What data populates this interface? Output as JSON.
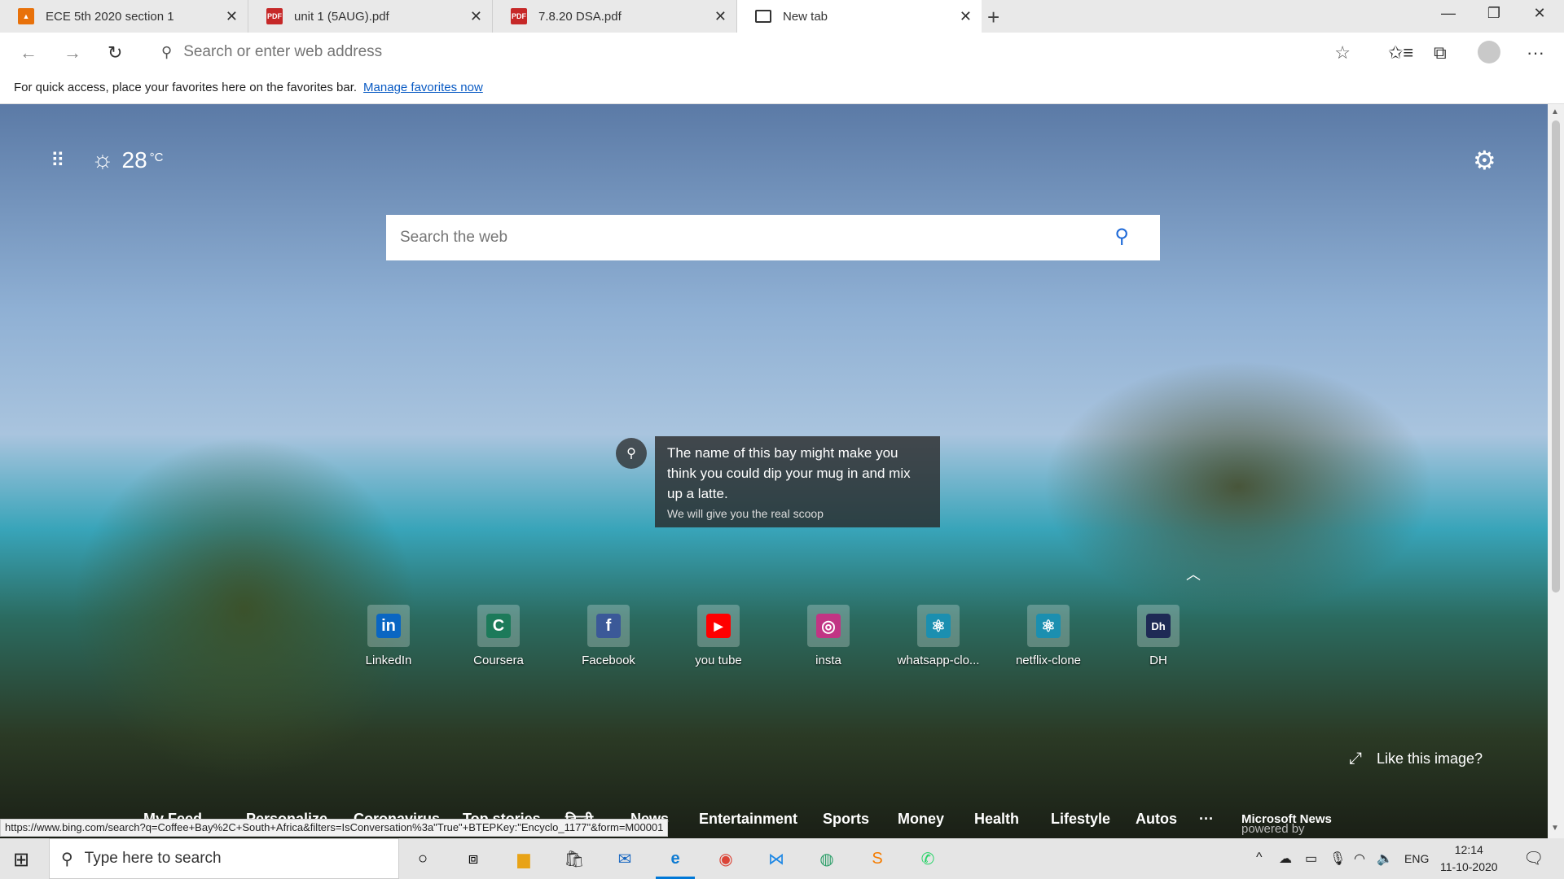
{
  "tabs": [
    {
      "title": "ECE 5th 2020 section 1",
      "icon": "classroom-icon",
      "color": "#e8710a"
    },
    {
      "title": "unit 1 (5AUG).pdf",
      "icon": "pdf-icon",
      "color": "#c62828"
    },
    {
      "title": "7.8.20 DSA.pdf",
      "icon": "pdf-icon",
      "color": "#c62828"
    },
    {
      "title": "New tab",
      "icon": "newtab-icon",
      "color": "#333333"
    }
  ],
  "address_bar": {
    "placeholder": "Search or enter web address"
  },
  "favorites_bar": {
    "message": "For quick access, place your favorites here on the favorites bar.",
    "link": "Manage favorites now"
  },
  "weather": {
    "temp": "28",
    "unit": "°C"
  },
  "web_search": {
    "placeholder": "Search the web"
  },
  "image_fact": {
    "headline": "The name of this bay might make you think you could dip your mug in and mix up a latte.",
    "subtext": "We will give you the real scoop"
  },
  "quick_links": [
    {
      "label": "LinkedIn",
      "glyph": "in",
      "color": "#0a66c2"
    },
    {
      "label": "Coursera",
      "glyph": "C",
      "color": "#1c7a5a"
    },
    {
      "label": "Facebook",
      "glyph": "f",
      "color": "#3b5998"
    },
    {
      "label": "you tube",
      "glyph": "▶",
      "color": "#ff0000"
    },
    {
      "label": "insta",
      "glyph": "◎",
      "color": "#c13584"
    },
    {
      "label": "whatsapp-clo...",
      "glyph": "⚛",
      "color": "#1b8fb0"
    },
    {
      "label": "netflix-clone",
      "glyph": "⚛",
      "color": "#1b8fb0"
    },
    {
      "label": "DH",
      "glyph": "Dh",
      "color": "#1e2a55"
    }
  ],
  "like_image": "Like this image?",
  "feed_nav": [
    "My Feed",
    "Personalize",
    "Coronavirus",
    "Top stories",
    "हिन्दी",
    "News",
    "Entertainment",
    "Sports",
    "Money",
    "Health",
    "Lifestyle",
    "Autos",
    "···"
  ],
  "powered_by": {
    "prefix": "powered by",
    "brand": "Microsoft News"
  },
  "status_url": "https://www.bing.com/search?q=Coffee+Bay%2C+South+Africa&filters=IsConversation%3a\"True\"+BTEPKey:\"Encyclo_1177\"&form=M00001",
  "taskbar": {
    "search_placeholder": "Type here to search",
    "language": "ENG",
    "time": "12:14",
    "date": "11-10-2020"
  }
}
